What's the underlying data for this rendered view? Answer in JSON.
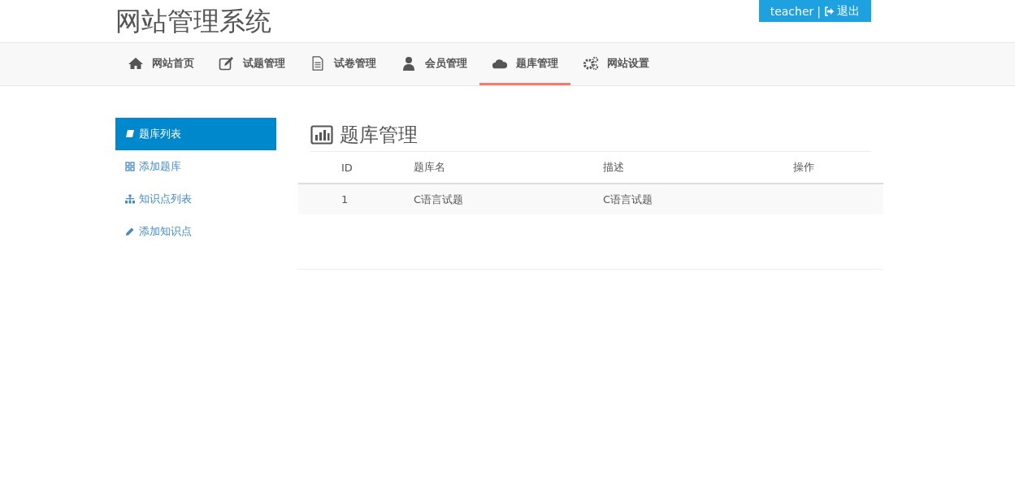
{
  "site_title": "网站管理系统",
  "user_bar": {
    "username": "teacher",
    "separator": "|",
    "logout": "退出"
  },
  "nav": [
    {
      "label": "网站首页",
      "selected": false
    },
    {
      "label": "试题管理",
      "selected": false
    },
    {
      "label": "试卷管理",
      "selected": false
    },
    {
      "label": "会员管理",
      "selected": false
    },
    {
      "label": "题库管理",
      "selected": true
    },
    {
      "label": "网站设置",
      "selected": false
    }
  ],
  "sidebar": [
    {
      "label": "题库列表",
      "selected": true
    },
    {
      "label": "添加题库",
      "selected": false
    },
    {
      "label": "知识点列表",
      "selected": false
    },
    {
      "label": "添加知识点",
      "selected": false
    }
  ],
  "heading": "题库管理",
  "table": {
    "columns": [
      "ID",
      "题库名",
      "描述",
      "操作"
    ],
    "rows": [
      {
        "cells": [
          "1",
          "C语言试题",
          "C语言试题"
        ]
      }
    ]
  }
}
